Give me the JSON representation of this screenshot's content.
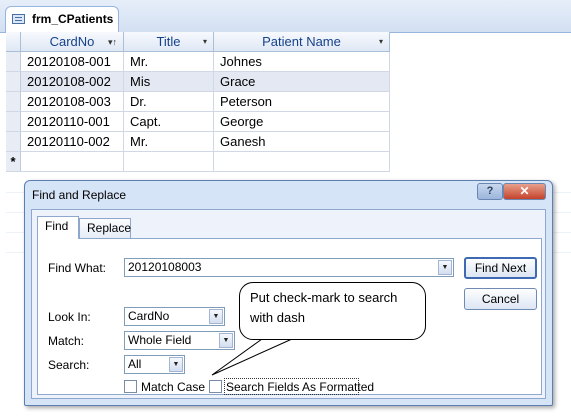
{
  "tab": {
    "label": "frm_CPatients",
    "icon": "form-icon"
  },
  "datasheet": {
    "columns": [
      "CardNo",
      "Title",
      "Patient Name"
    ],
    "rows": [
      {
        "card": "20120108-001",
        "title": "Mr.",
        "name": "Johnes"
      },
      {
        "card": "20120108-002",
        "title": "Mis",
        "name": "Grace"
      },
      {
        "card": "20120108-003",
        "title": "Dr.",
        "name": "Peterson"
      },
      {
        "card": "20120110-001",
        "title": "Capt.",
        "name": "George"
      },
      {
        "card": "20120110-002",
        "title": "Mr.",
        "name": "Ganesh"
      }
    ],
    "new_row_marker": "*",
    "sort_marker": "▾↑",
    "filter_marker": "▾"
  },
  "dialog": {
    "title": "Find and Replace",
    "help_label": "?",
    "close_label": "✕",
    "tabs": [
      "Find",
      "Replace"
    ],
    "find_what_label": "Find What:",
    "find_what_value": "20120108003",
    "look_in_label": "Look In:",
    "look_in_value": "CardNo",
    "match_label": "Match:",
    "match_value": "Whole Field",
    "search_label": "Search:",
    "search_value": "All",
    "match_case_label": "Match Case",
    "match_case_checked": false,
    "search_formatted_label": "Search Fields As Formatted",
    "search_formatted_checked": false,
    "find_next_label": "Find Next",
    "cancel_label": "Cancel"
  },
  "callout": {
    "text": "Put check-mark to search with dash"
  }
}
